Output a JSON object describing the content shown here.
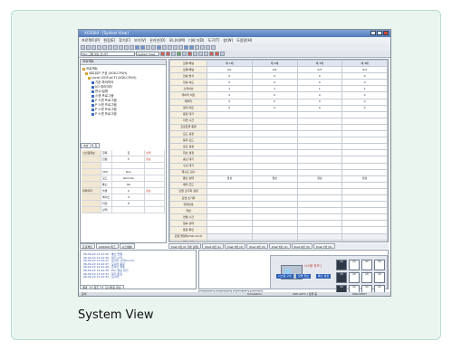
{
  "caption": "System View",
  "app": {
    "title": "XG5000 - [System View]",
    "menu": [
      "프로젝트(P)",
      "편집(E)",
      "찾기(F)",
      "보기(V)",
      "온라인(O)",
      "모니터(M)",
      "디버그(D)",
      "도구(T)",
      "창(W)",
      "도움말(H)"
    ],
    "toolbar_combo": "PLC 그룹 정보 모니터",
    "toolbar_combo2": "System View"
  },
  "left_pane": {
    "header": "프로젝트",
    "tree": [
      "프로젝트",
      "네트워크 구성 (XGK-CPUH)",
      "Local (XGP-ACF1/XGK-CPUH)",
      "기본 파라미터",
      "I/O 파라미터",
      "변수/설명",
      "스캔 프로그램",
      "P 스캔 프로그램",
      "P 스캔 프로그램",
      "P 스캔 프로그램",
      "P 스캔 프로그램"
    ],
    "prop_tabs": [
      "속성",
      "값"
    ],
    "props": [
      {
        "k": "시스템정보",
        "a": "항목",
        "b": "값",
        "c": "상태"
      },
      {
        "k": "",
        "a": "전원",
        "b": "5",
        "c": "정상"
      },
      {
        "k": "",
        "a": "",
        "b": "",
        "c": ""
      },
      {
        "k": "",
        "a": "CPU",
        "b": "Run",
        "c": ""
      },
      {
        "k": "",
        "a": "모드",
        "b": "Remote",
        "c": ""
      },
      {
        "k": "",
        "a": "통신",
        "b": "OK",
        "c": ""
      },
      {
        "k": "파라미터",
        "a": "슬롯",
        "b": "0",
        "c": "정상"
      },
      {
        "k": "",
        "a": "베이스",
        "b": "0",
        "c": ""
      },
      {
        "k": "",
        "a": "타입",
        "b": "8",
        "c": ""
      },
      {
        "k": "",
        "a": "상태",
        "b": "",
        "c": ""
      }
    ],
    "bottom_tabs": [
      "프로젝트",
      "XG5000 태그",
      "시스템뷰"
    ]
  },
  "grid": {
    "headers": [
      "모듈/채널",
      "채 1채",
      "채 2채",
      "채 3채",
      "채 4채"
    ],
    "rows": [
      {
        "label": "모듈/채널",
        "v": [
          "0/1",
          "0/2",
          "0/3",
          "0/4"
        ]
      },
      {
        "label": "전송 방식",
        "v": [
          "0",
          "0",
          "0",
          "0"
        ]
      },
      {
        "label": "전송 속도",
        "v": [
          "0",
          "0",
          "0",
          "0"
        ]
      },
      {
        "label": "스테이션",
        "v": [
          "1",
          "1",
          "1",
          "1"
        ]
      },
      {
        "label": "데이터 비트",
        "v": [
          "0",
          "0",
          "0",
          "0"
        ]
      },
      {
        "label": "패리티",
        "v": [
          "0",
          "0",
          "0",
          "0"
        ]
      },
      {
        "label": "정지 비트",
        "v": [
          "0",
          "0",
          "0",
          "0"
        ]
      },
      {
        "label": "응답 대기",
        "v": [
          "",
          "",
          "",
          ""
        ]
      },
      {
        "label": "지연 시간",
        "v": [
          "",
          "",
          "",
          ""
        ]
      },
      {
        "label": "프로토콜 종류",
        "v": [
          "",
          "",
          "",
          ""
        ]
      },
      {
        "label": "모드 설정",
        "v": [
          "",
          "",
          "",
          ""
        ]
      },
      {
        "label": "동작 모드",
        "v": [
          "",
          "",
          "",
          ""
        ]
      },
      {
        "label": "포트 설정",
        "v": [
          "",
          "",
          "",
          ""
        ]
      },
      {
        "label": "회선 설정",
        "v": [
          "",
          "",
          "",
          ""
        ]
      },
      {
        "label": "송신 대기",
        "v": [
          "",
          "",
          "",
          ""
        ]
      },
      {
        "label": "수신 대기",
        "v": [
          "",
          "",
          "",
          ""
        ]
      },
      {
        "label": "재시도 횟수",
        "v": [
          "",
          "",
          "",
          ""
        ]
      },
      {
        "label": "통신 상태",
        "v": [
          "정상",
          "정상",
          "정상",
          "정상"
        ]
      },
      {
        "label": "에러 코드",
        "v": [
          "",
          "",
          "",
          ""
        ]
      },
      {
        "label": "모뎀 초기화 설정",
        "v": [
          "",
          "",
          "",
          ""
        ]
      },
      {
        "label": "모뎀 초기화",
        "v": [
          "",
          "",
          "",
          ""
        ]
      },
      {
        "label": "전화번호",
        "v": [
          "",
          "",
          "",
          ""
        ]
      },
      {
        "label": "국번",
        "v": [
          "",
          "",
          "",
          ""
        ]
      },
      {
        "label": "연결 시간",
        "v": [
          "",
          "",
          "",
          ""
        ]
      },
      {
        "label": "접속 상태",
        "v": [
          "",
          "",
          "",
          ""
        ]
      },
      {
        "label": "응답 확인",
        "v": [
          "",
          "",
          "",
          ""
        ]
      },
      {
        "label": "모뎀 명령어(Dial Cmd)",
        "v": [
          "",
          "",
          "",
          ""
        ]
      },
      {
        "label": "모뎀 설정",
        "v": [
          "",
          "0",
          "",
          ""
        ]
      }
    ],
    "tabs": [
      "Pnet 1번 (0 기본 설정)",
      "Pnet 2번 (1)",
      "Pnet 3번 (2)",
      "Pnet 4번 (3)",
      "Pnet 5번 (4)",
      "Pnet 6번 (5)",
      "Pnet 7번 (6)"
    ]
  },
  "log": {
    "lines": [
      "06-09-22 11:22:25 : 통신 연결",
      "06-09-22 11:22:26 : 읽기 시작",
      "06-09-22 11:22:27 : 모니터 시작(Local)",
      "06-09-22 11:22:27 : 모니터 종료",
      "06-09-22 11:22:28 : 온라인 접속",
      "06-09-22 11:22:30 : PLC 정보 읽기",
      "06-09-22 11:22:31 : 읽기 완료",
      "06-09-22 11:22:32 : 모니터"
    ],
    "tabs": [
      "결과",
      "참조",
      "모니터링 정보"
    ]
  },
  "monitor": {
    "red_label": "[ 시스템 정보 ]",
    "panel_title": "통신 설정",
    "modules": [
      "I/O",
      "I/O",
      "I/O",
      "I/O",
      "I/O",
      "I/O",
      "I/O",
      "I/O",
      "I/O",
      "I/O",
      "I/O",
      "I/O"
    ],
    "buttons": [
      "시스템 구성",
      "모듈 정보",
      "통신 설정"
    ],
    "tabs": [
      "출력 결과",
      "찾기 결과",
      "통신 결과",
      "메시지"
    ]
  },
  "statusbar": {
    "left": "준비",
    "mid": "Simulation",
    "right": "XGP-ACF1 / 실행 중",
    "far": "XGK-CPUH"
  }
}
